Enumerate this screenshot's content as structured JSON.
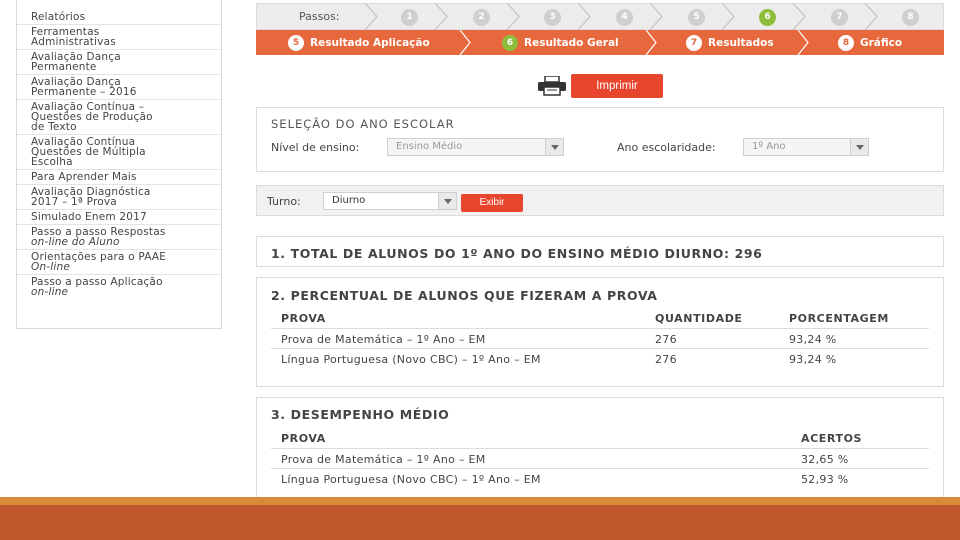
{
  "sidebar": {
    "items": [
      {
        "lines": [
          "Relatórios"
        ]
      },
      {
        "lines": [
          "Ferramentas",
          "Administrativas"
        ]
      },
      {
        "lines": [
          "Avaliação Dança",
          "Permanente"
        ]
      },
      {
        "lines": [
          "Avaliação Dança",
          "Permanente – 2016"
        ]
      },
      {
        "lines": [
          "Avaliação Contínua –",
          "Questões de Produção",
          "de Texto"
        ]
      },
      {
        "lines": [
          "Avaliação Contínua",
          "Questões de Múltipla",
          "Escolha"
        ]
      },
      {
        "lines": [
          "Para Aprender Mais"
        ]
      },
      {
        "lines": [
          "Avaliação Diagnóstica",
          "2017 – 1ª Prova"
        ]
      },
      {
        "lines": [
          "Simulado Enem 2017"
        ]
      },
      {
        "lines": [
          "Passo a passo Respostas",
          "on-line do Aluno"
        ]
      },
      {
        "lines": [
          "Orientações para o PAAE",
          "On-line"
        ]
      },
      {
        "lines": [
          "Passo a passo Aplicação",
          "on-line"
        ]
      }
    ]
  },
  "steps": {
    "label": "Passos:",
    "numbers": [
      "1",
      "2",
      "3",
      "4",
      "5",
      "6",
      "7",
      "8"
    ],
    "active": "6",
    "sub": [
      {
        "num": "5",
        "label": "Resultado Aplicação"
      },
      {
        "num": "6",
        "label": "Resultado Geral"
      },
      {
        "num": "7",
        "label": "Resultados"
      },
      {
        "num": "8",
        "label": "Gráfico"
      }
    ]
  },
  "print": {
    "label": "Imprimir"
  },
  "selection": {
    "title": "SELEÇÃO DO ANO ESCOLAR",
    "level_label": "Nível de ensino:",
    "level_value": "Ensino Médio",
    "year_label": "Ano escolaridade:",
    "year_value": "1º Ano"
  },
  "turno": {
    "label": "Turno:",
    "value": "Diurno",
    "button": "Exibir"
  },
  "section1": {
    "title": "1. TOTAL DE ALUNOS DO 1º ANO DO ENSINO MÉDIO DIURNO: 296"
  },
  "section2": {
    "title": "2. PERCENTUAL DE ALUNOS QUE FIZERAM A PROVA",
    "headers": [
      "PROVA",
      "QUANTIDADE",
      "PORCENTAGEM"
    ],
    "rows": [
      [
        "Prova de Matemática – 1º Ano – EM",
        "276",
        "93,24 %"
      ],
      [
        "Língua Portuguesa (Novo CBC) – 1º Ano – EM",
        "276",
        "93,24 %"
      ]
    ]
  },
  "section3": {
    "title": "3. DESEMPENHO MÉDIO",
    "headers": [
      "PROVA",
      "ACERTOS"
    ],
    "rows": [
      [
        "Prova de Matemática – 1º Ano – EM",
        "32,65 %"
      ],
      [
        "Língua Portuguesa (Novo CBC) – 1º Ano – EM",
        "52,93 %"
      ]
    ]
  }
}
